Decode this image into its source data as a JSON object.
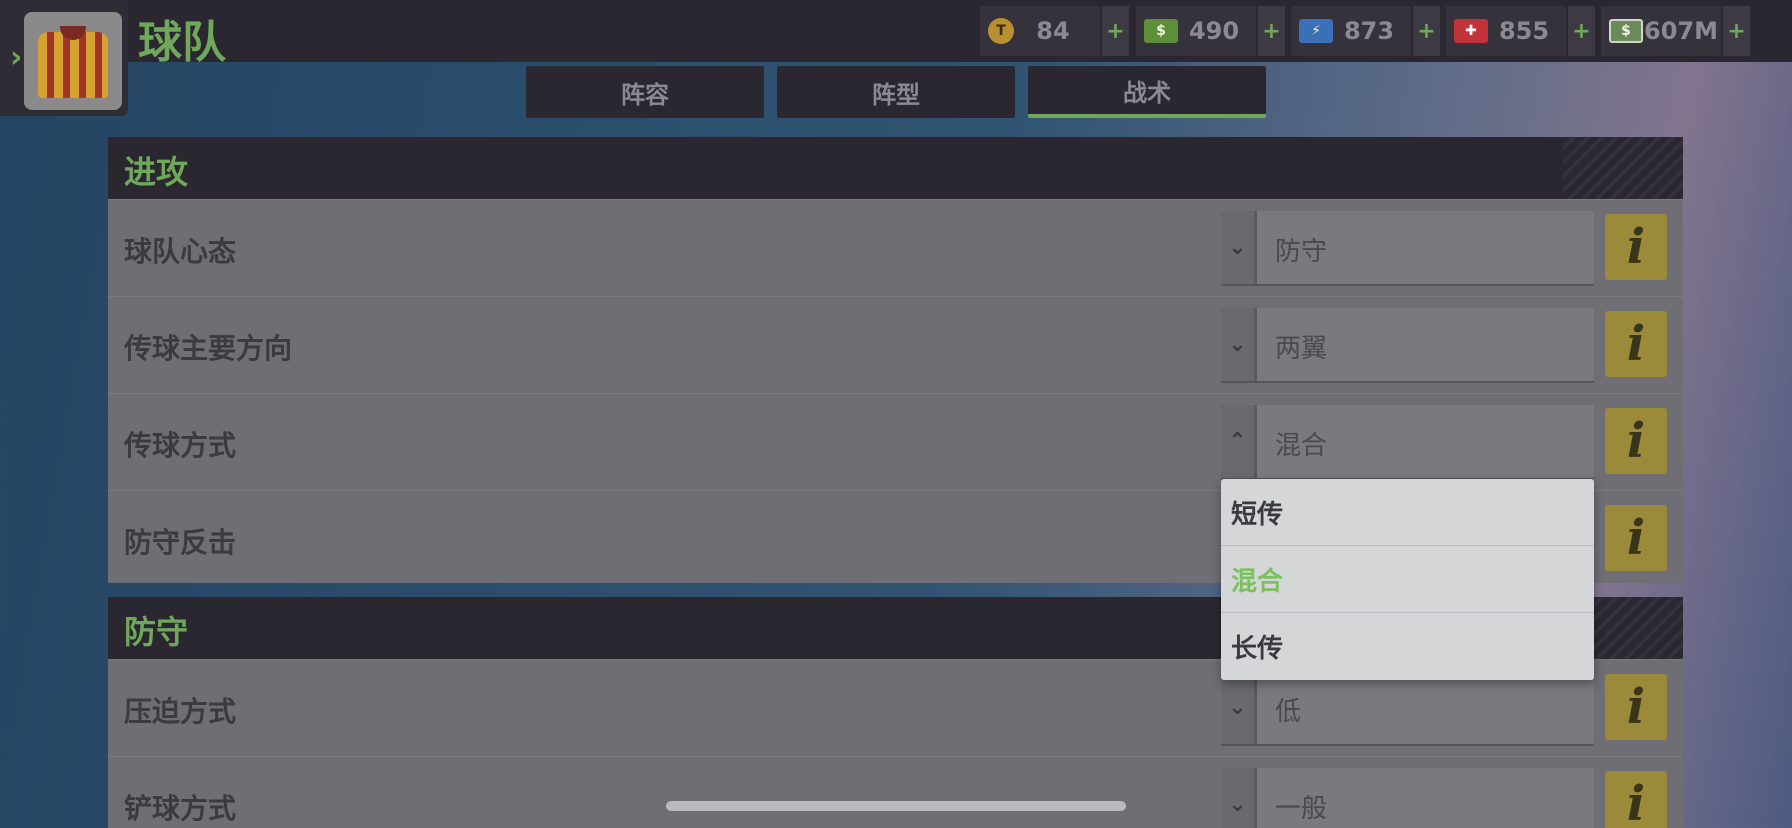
{
  "header": {
    "title": "球队"
  },
  "currencies": [
    {
      "icon": "token-icon",
      "value": "84"
    },
    {
      "icon": "cash-icon",
      "value": "490"
    },
    {
      "icon": "energy-icon",
      "value": "873"
    },
    {
      "icon": "medic-icon",
      "value": "855"
    },
    {
      "icon": "money-icon",
      "value": "607M"
    }
  ],
  "plus_label": "+",
  "tabs": [
    {
      "label": "阵容",
      "active": false
    },
    {
      "label": "阵型",
      "active": false
    },
    {
      "label": "战术",
      "active": true
    }
  ],
  "attack": {
    "title": "进攻",
    "rows": [
      {
        "label": "球队心态",
        "value": "防守",
        "expanded": false
      },
      {
        "label": "传球主要方向",
        "value": "两翼",
        "expanded": false
      },
      {
        "label": "传球方式",
        "value": "混合",
        "expanded": true
      },
      {
        "label": "防守反击",
        "value": "",
        "expanded": false
      }
    ]
  },
  "defense": {
    "title": "防守",
    "rows": [
      {
        "label": "压迫方式",
        "value": "低",
        "expanded": false
      },
      {
        "label": "铲球方式",
        "value": "一般",
        "expanded": false
      }
    ]
  },
  "dropdown": {
    "options": [
      "短传",
      "混合",
      "长传"
    ],
    "selected": "混合"
  },
  "info_glyph": "i",
  "colors": {
    "accent": "#6fa85a",
    "selected_option": "#7cc160",
    "bar": "#2a2730"
  }
}
